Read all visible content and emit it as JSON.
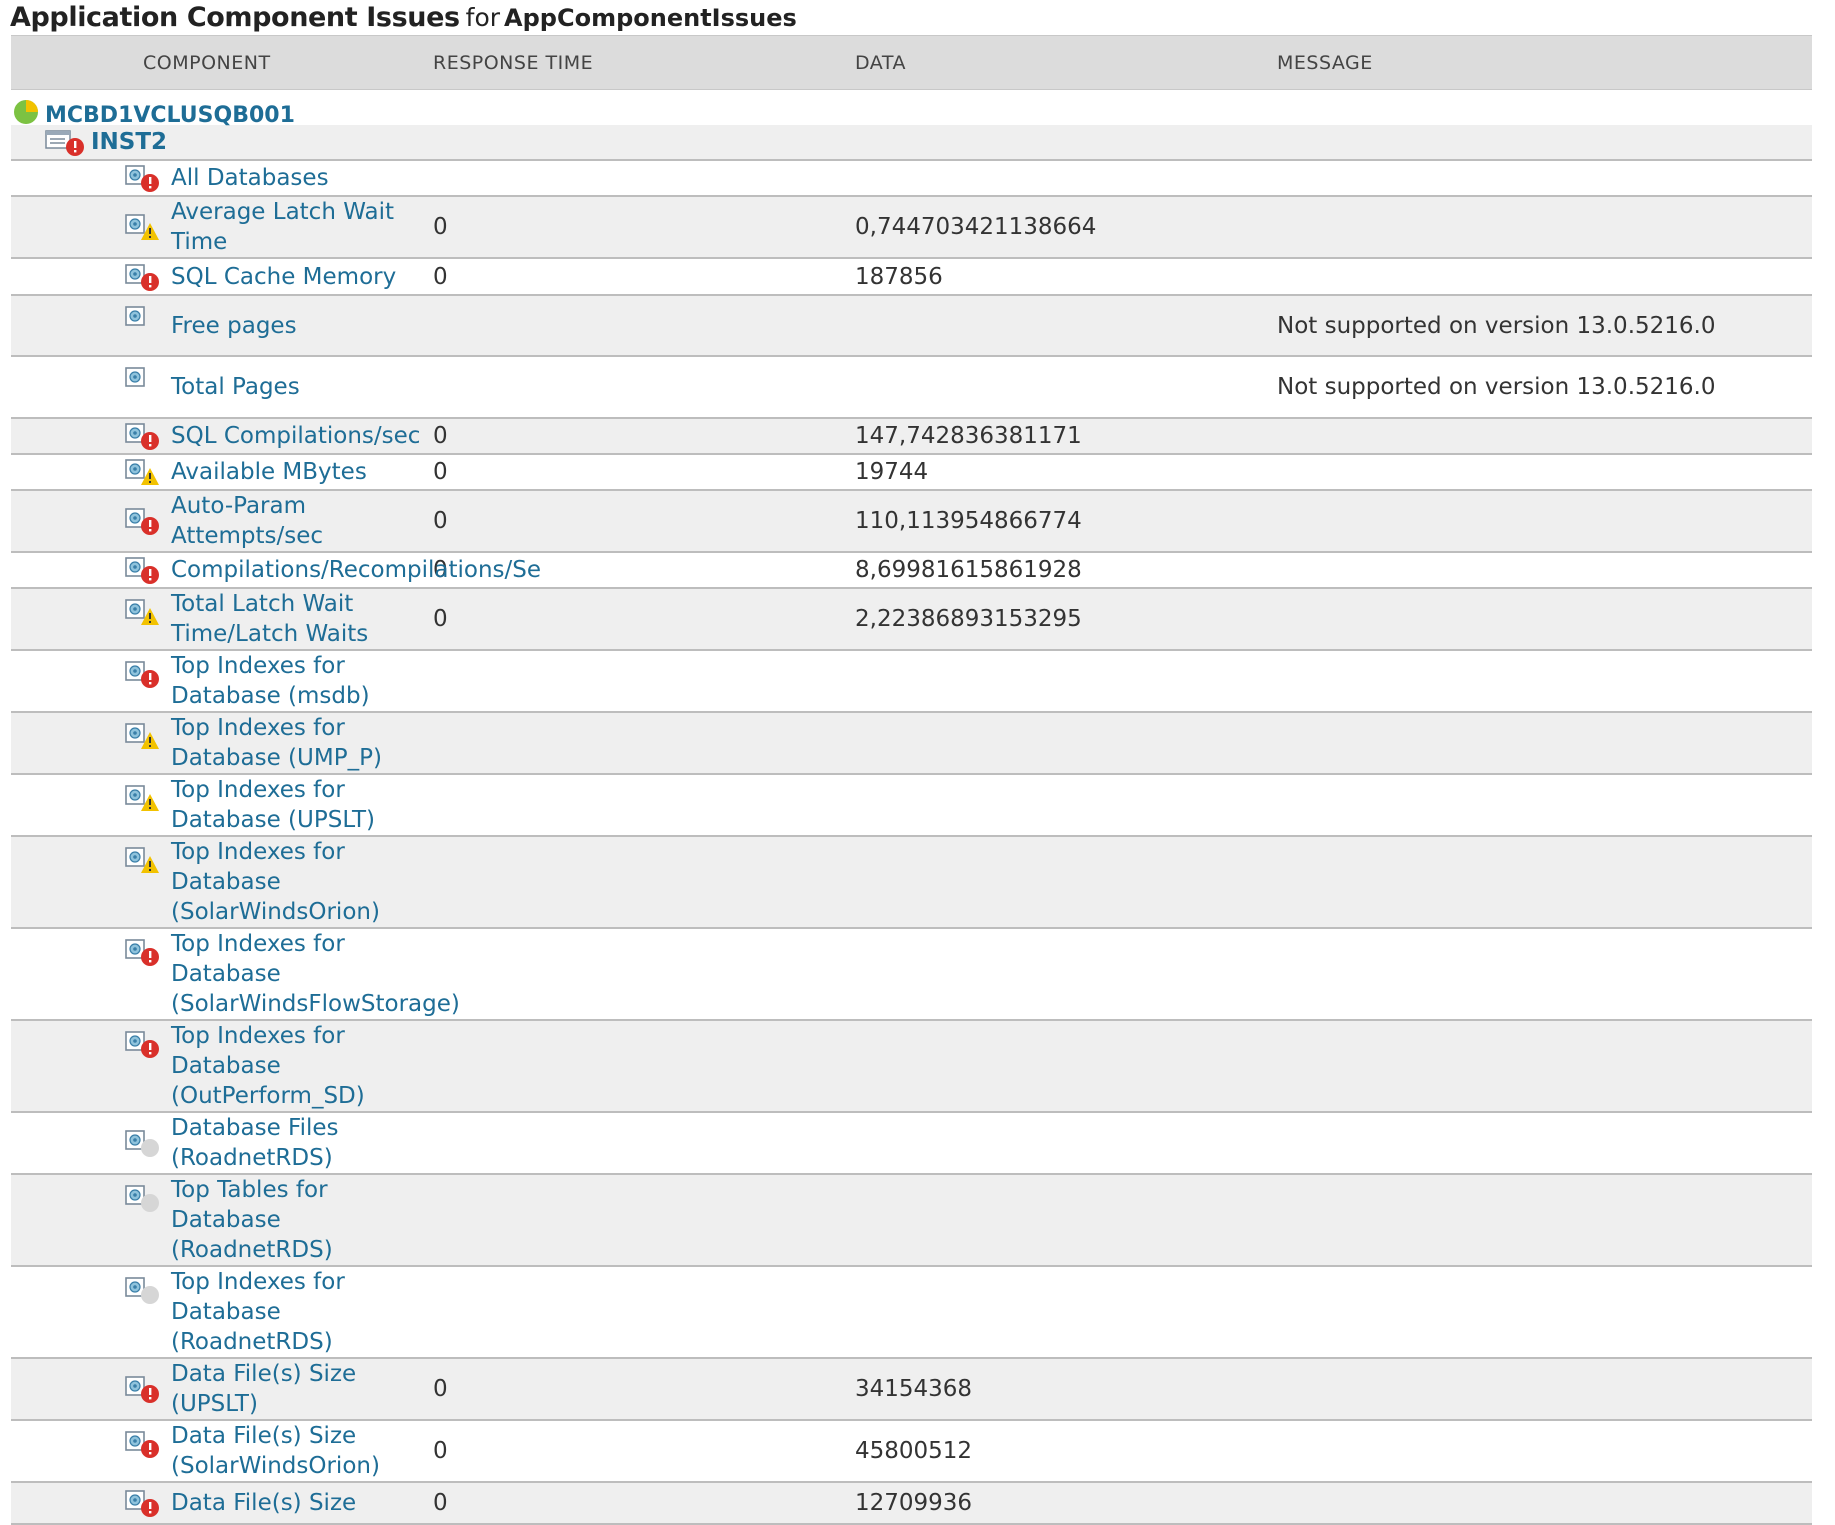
{
  "title": {
    "main": "Application Component Issues",
    "for_label": "for",
    "app_name": "AppComponentIssues"
  },
  "columns": {
    "component": "COMPONENT",
    "response_time": "RESPONSE TIME",
    "data": "DATA",
    "message": "MESSAGE"
  },
  "host": {
    "name": "MCBD1VCLUSQB001",
    "status": "up"
  },
  "instance": {
    "name": "INST2",
    "status": "critical"
  },
  "colors": {
    "link": "#1e6d96",
    "critical": "#d9302a",
    "warning": "#f2c200",
    "unknown": "#d6d6d6",
    "up": "#7cc242"
  },
  "rows": [
    {
      "name": "All Databases",
      "status": "critical",
      "response": "",
      "data": "",
      "message": ""
    },
    {
      "name": "Average Latch Wait Time",
      "status": "warning",
      "response": "0",
      "data": "0,744703421138664",
      "message": ""
    },
    {
      "name": "SQL Cache Memory",
      "status": "critical",
      "response": "0",
      "data": "187856",
      "message": ""
    },
    {
      "name": "Free pages",
      "status": "none",
      "response": "",
      "data": "",
      "message": "Not supported on version 13.0.5216.0"
    },
    {
      "name": "Total Pages",
      "status": "none",
      "response": "",
      "data": "",
      "message": "Not supported on version 13.0.5216.0"
    },
    {
      "name": "SQL Compilations/sec",
      "status": "critical",
      "response": "0",
      "data": "147,742836381171",
      "message": ""
    },
    {
      "name": "Available MBytes",
      "status": "warning",
      "response": "0",
      "data": "19744",
      "message": ""
    },
    {
      "name": "Auto-Param Attempts/sec",
      "status": "critical",
      "response": "0",
      "data": "110,113954866774",
      "message": ""
    },
    {
      "name": "Compilations/Recompilations/Se",
      "status": "critical",
      "response": "0",
      "data": "8,69981615861928",
      "message": ""
    },
    {
      "name": "Total Latch Wait Time/Latch Waits",
      "status": "warning",
      "response": "0",
      "data": "2,22386893153295",
      "message": ""
    },
    {
      "name": "Top Indexes for Database (msdb)",
      "status": "critical",
      "response": "",
      "data": "",
      "message": ""
    },
    {
      "name": "Top Indexes for Database (UMP_P)",
      "status": "warning",
      "response": "",
      "data": "",
      "message": ""
    },
    {
      "name": "Top Indexes for Database (UPSLT)",
      "status": "warning",
      "response": "",
      "data": "",
      "message": ""
    },
    {
      "name": "Top Indexes for Database (SolarWindsOrion)",
      "status": "warning",
      "response": "",
      "data": "",
      "message": ""
    },
    {
      "name": "Top Indexes for Database (SolarWindsFlowStorage)",
      "status": "critical",
      "response": "",
      "data": "",
      "message": ""
    },
    {
      "name": "Top Indexes for Database (OutPerform_SD)",
      "status": "critical",
      "response": "",
      "data": "",
      "message": ""
    },
    {
      "name": "Database Files (RoadnetRDS)",
      "status": "unknown",
      "response": "",
      "data": "",
      "message": ""
    },
    {
      "name": "Top Tables for Database (RoadnetRDS)",
      "status": "unknown",
      "response": "",
      "data": "",
      "message": ""
    },
    {
      "name": "Top Indexes for Database (RoadnetRDS)",
      "status": "unknown",
      "response": "",
      "data": "",
      "message": ""
    },
    {
      "name": "Data File(s) Size (UPSLT)",
      "status": "critical",
      "response": "0",
      "data": "34154368",
      "message": ""
    },
    {
      "name": "Data File(s) Size (SolarWindsOrion)",
      "status": "critical",
      "response": "0",
      "data": "45800512",
      "message": ""
    },
    {
      "name": "Data File(s) Size",
      "status": "critical",
      "response": "0",
      "data": "12709936",
      "message": ""
    }
  ]
}
